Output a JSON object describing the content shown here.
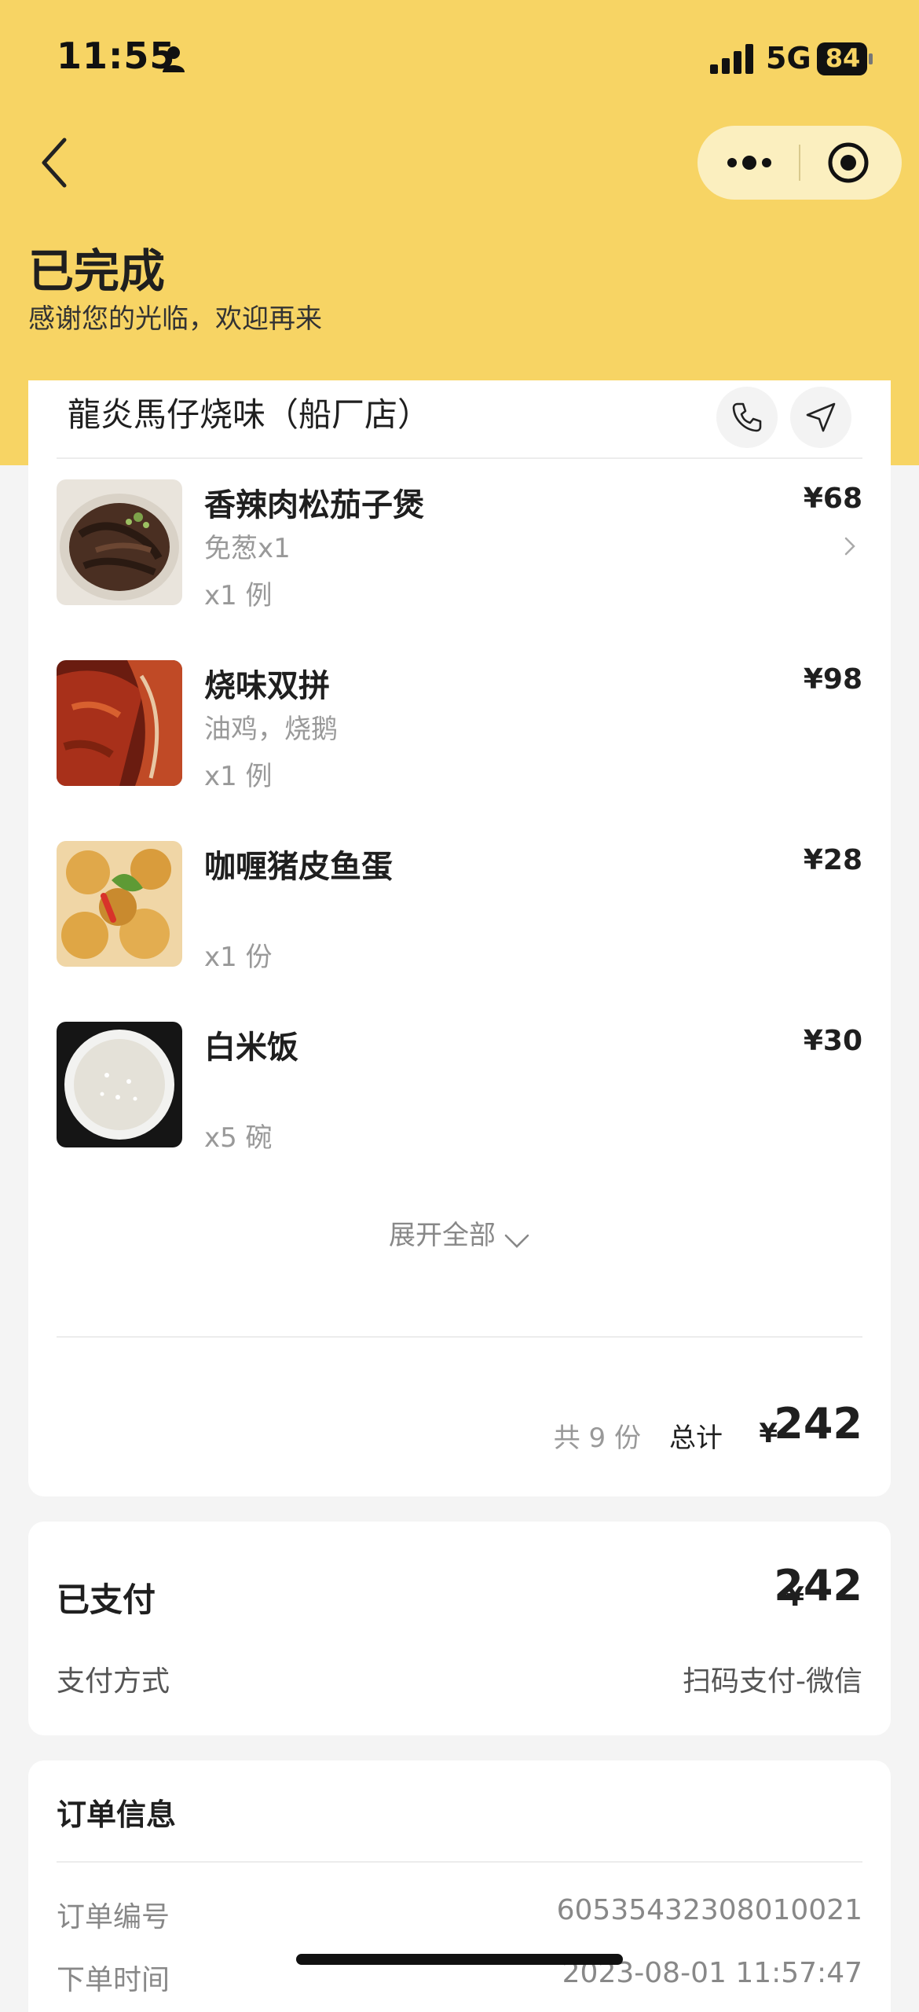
{
  "status_bar": {
    "time": "11:55",
    "network": "5G",
    "battery": "84"
  },
  "header": {
    "title": "已完成",
    "subtitle": "感谢您的光临，欢迎再来"
  },
  "shop": {
    "name": "龍炎馬仔烧味（船厂店）"
  },
  "items": [
    {
      "name": "香辣肉松茄子煲",
      "spec": "免葱x1",
      "qty": "x1 例",
      "price": "¥68",
      "image": "braised-eggplant-photo"
    },
    {
      "name": "烧味双拼",
      "spec": "油鸡，烧鹅",
      "qty": "x1 例",
      "price": "¥98",
      "image": "roast-meat-photo"
    },
    {
      "name": "咖喱猪皮鱼蛋",
      "spec": "",
      "qty": "x1 份",
      "price": "¥28",
      "image": "curry-fishball-photo"
    },
    {
      "name": "白米饭",
      "spec": "",
      "qty": "x5 碗",
      "price": "¥30",
      "image": "white-rice-photo"
    }
  ],
  "expand_label": "展开全部",
  "summary": {
    "count": "共 9 份",
    "total_label": "总计",
    "currency": "¥",
    "total": "242"
  },
  "payment": {
    "title": "已支付",
    "currency": "¥",
    "amount": "242",
    "method_label": "支付方式",
    "method_value": "扫码支付-微信"
  },
  "order_info": {
    "title": "订单信息",
    "number_label": "订单编号",
    "number_value": "60535432308010021",
    "time_label": "下单时间",
    "time_value": "2023-08-01 11:57:47"
  },
  "colors": {
    "header_bg": "#f7d464",
    "capsule_bg": "#fbefbf",
    "page_bg": "#f4f4f4"
  }
}
